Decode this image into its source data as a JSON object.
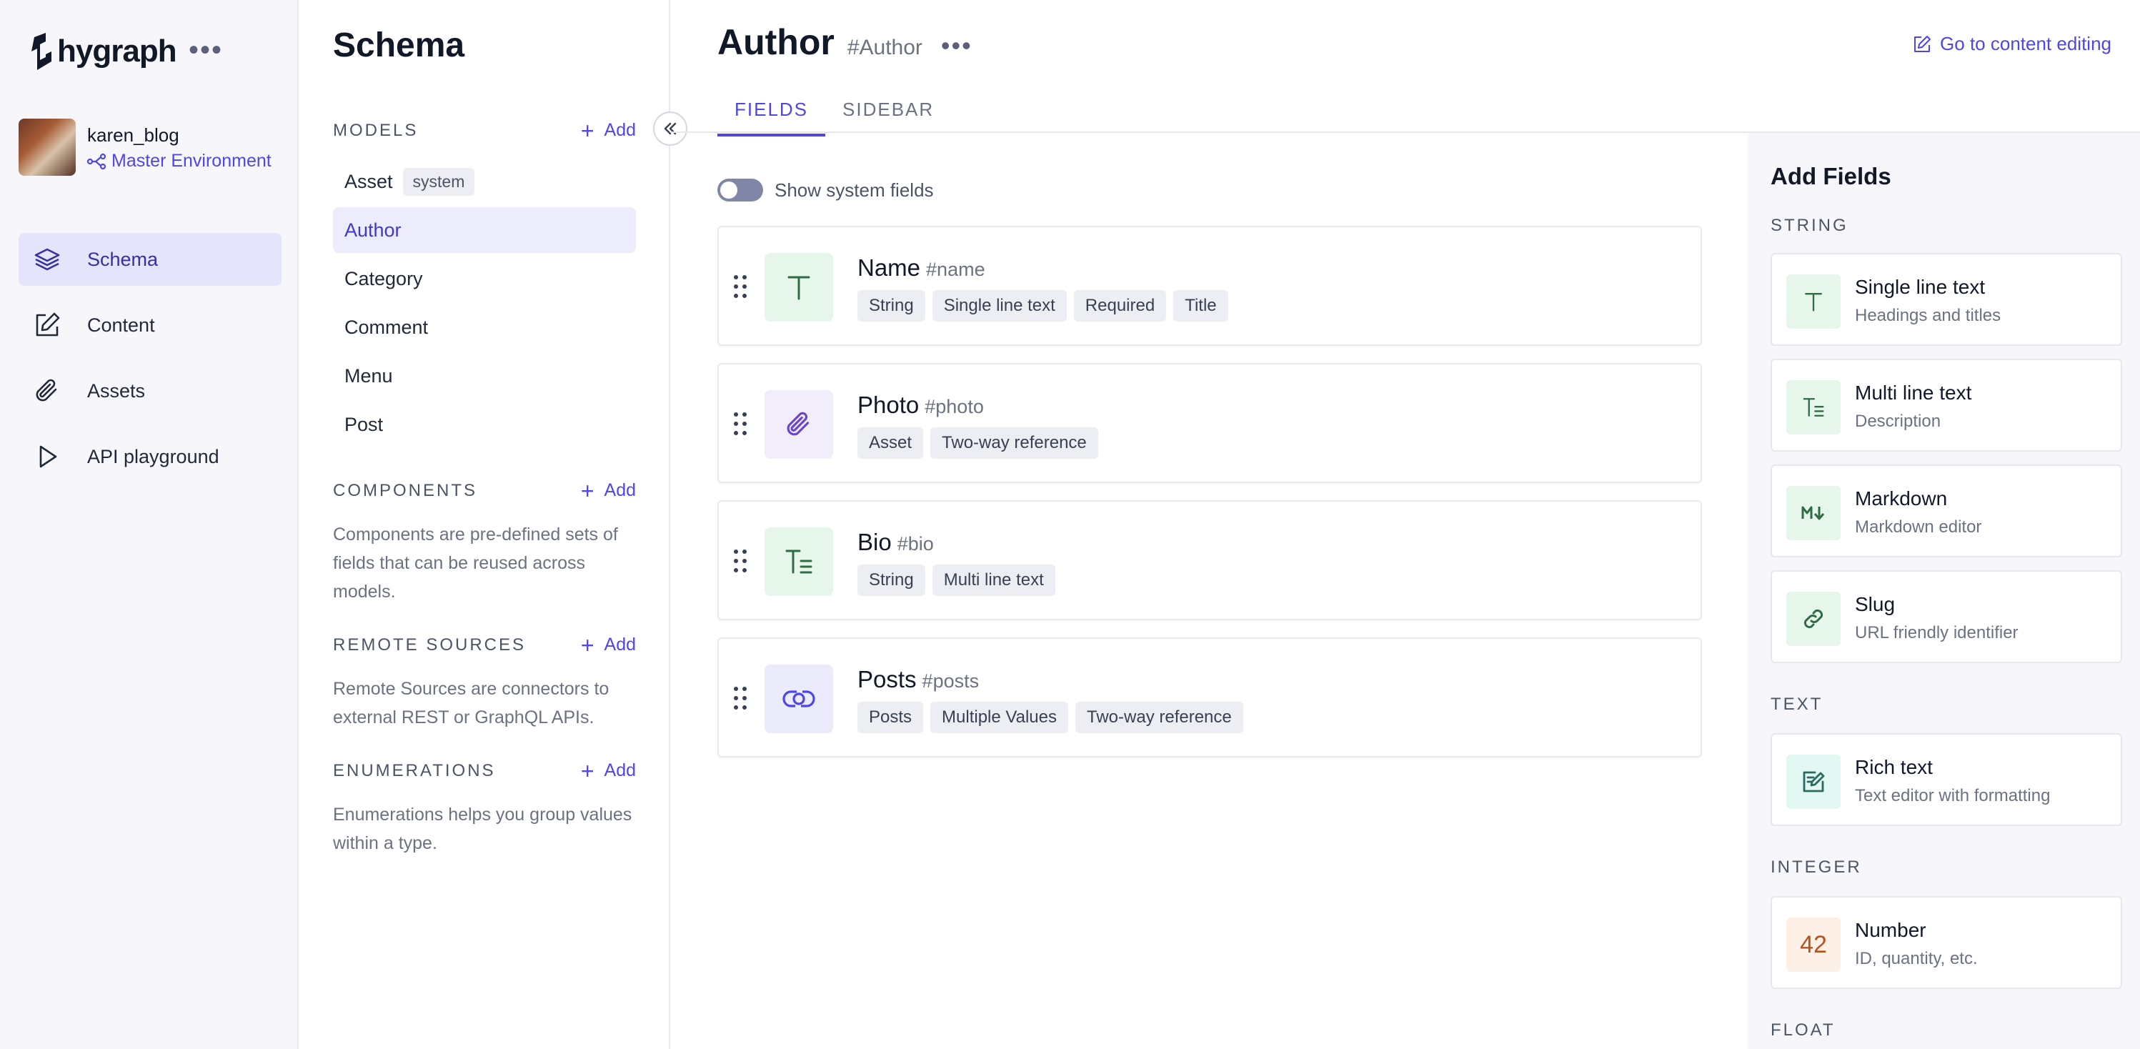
{
  "app": {
    "logo_text": "hygraph",
    "project_name": "karen_blog",
    "environment": "Master Environment"
  },
  "nav": {
    "items": [
      {
        "label": "Schema",
        "icon": "layers-icon",
        "active": true
      },
      {
        "label": "Content",
        "icon": "edit-icon",
        "active": false
      },
      {
        "label": "Assets",
        "icon": "paperclip-icon",
        "active": false
      },
      {
        "label": "API playground",
        "icon": "play-icon",
        "active": false
      }
    ]
  },
  "schema": {
    "title": "Schema",
    "models_label": "MODELS",
    "add_label": "Add",
    "models": [
      {
        "label": "Asset",
        "badge": "system"
      },
      {
        "label": "Author",
        "active": true
      },
      {
        "label": "Category"
      },
      {
        "label": "Comment"
      },
      {
        "label": "Menu"
      },
      {
        "label": "Post"
      }
    ],
    "components_label": "COMPONENTS",
    "components_desc": "Components are pre-defined sets of fields that can be reused across models.",
    "remote_label": "REMOTE SOURCES",
    "remote_desc": "Remote Sources are connectors to external REST or GraphQL APIs.",
    "enum_label": "ENUMERATIONS",
    "enum_desc": "Enumerations helps you group values within a type."
  },
  "main": {
    "title": "Author",
    "api_id": "#Author",
    "goto_label": "Go to content editing",
    "tabs": [
      {
        "label": "FIELDS",
        "active": true
      },
      {
        "label": "SIDEBAR",
        "active": false
      }
    ],
    "toggle_label": "Show system fields",
    "fields": [
      {
        "name": "Name",
        "api": "#name",
        "icon": "text-icon",
        "tags": [
          "String",
          "Single line text",
          "Required",
          "Title"
        ]
      },
      {
        "name": "Photo",
        "api": "#photo",
        "icon": "paperclip-icon",
        "tags": [
          "Asset",
          "Two-way reference"
        ]
      },
      {
        "name": "Bio",
        "api": "#bio",
        "icon": "multiline-text-icon",
        "tags": [
          "String",
          "Multi line text"
        ]
      },
      {
        "name": "Posts",
        "api": "#posts",
        "icon": "link-icon",
        "tags": [
          "Posts",
          "Multiple Values",
          "Two-way reference"
        ]
      }
    ]
  },
  "add_fields": {
    "title": "Add Fields",
    "string_label": "STRING",
    "text_label": "TEXT",
    "integer_label": "INTEGER",
    "float_label": "FLOAT",
    "types": [
      {
        "name": "Single line text",
        "desc": "Headings and titles",
        "icon": "text-icon"
      },
      {
        "name": "Multi line text",
        "desc": "Description",
        "icon": "multiline-text-icon"
      },
      {
        "name": "Markdown",
        "desc": "Markdown editor",
        "icon": "markdown-icon"
      },
      {
        "name": "Slug",
        "desc": "URL friendly identifier",
        "icon": "link-icon"
      },
      {
        "name": "Rich text",
        "desc": "Text editor with formatting",
        "icon": "rich-text-icon"
      },
      {
        "name": "Number",
        "desc": "ID, quantity, etc.",
        "icon": "number-icon",
        "glyph": "42"
      }
    ]
  },
  "colors": {
    "accent": "#4f46e5",
    "nav_active_bg": "#e4e4fb"
  }
}
